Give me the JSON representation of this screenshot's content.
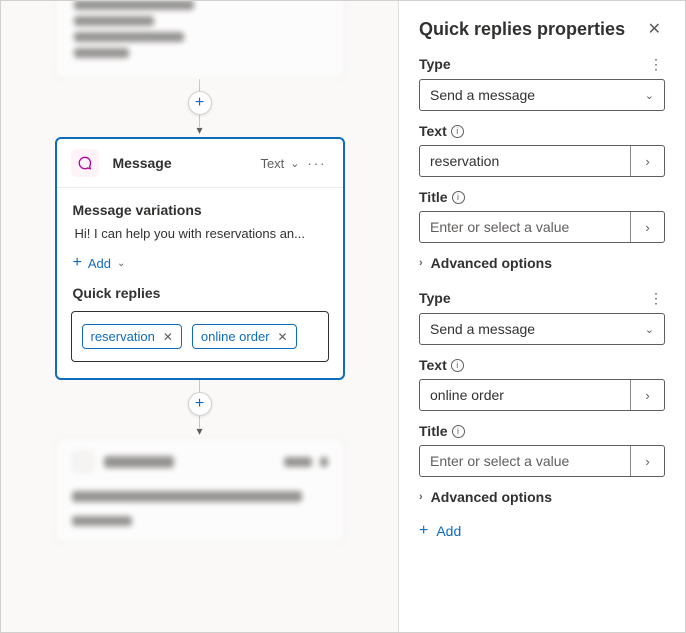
{
  "panel": {
    "title": "Quick replies properties",
    "advanced_label": "Advanced options",
    "add_label": "Add",
    "type_label": "Type",
    "text_label": "Text",
    "title_label": "Title",
    "title_placeholder": "Enter or select a value",
    "replies": [
      {
        "type_value": "Send a message",
        "text_value": "reservation",
        "title_value": ""
      },
      {
        "type_value": "Send a message",
        "text_value": "online order",
        "title_value": ""
      }
    ]
  },
  "canvas": {
    "message_node": {
      "heading": "Message",
      "kind": "Text",
      "variations_label": "Message variations",
      "variation_preview": "Hi! I can help you with reservations an...",
      "add_label": "Add",
      "quick_replies_label": "Quick replies",
      "chips": [
        "reservation",
        "online order"
      ]
    }
  }
}
